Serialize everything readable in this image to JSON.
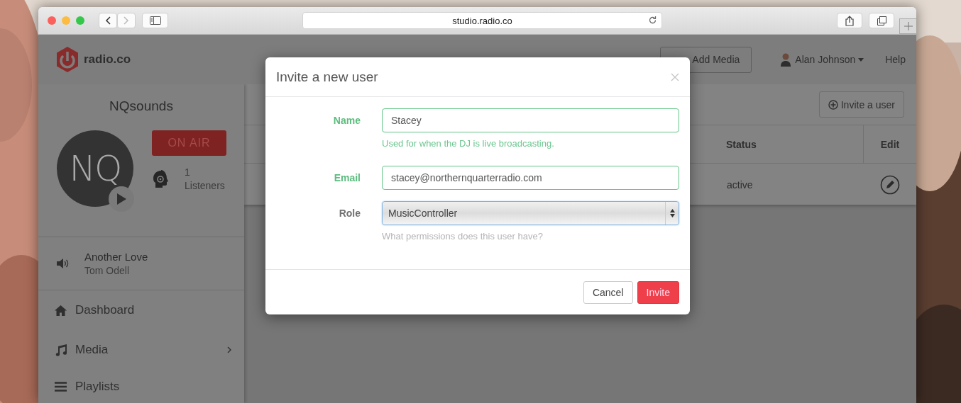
{
  "browser": {
    "url": "studio.radio.co"
  },
  "header": {
    "logo_text": "radio.co",
    "add_media_button": "Add Media",
    "user_name": "Alan Johnson",
    "help_link": "Help"
  },
  "sidebar": {
    "station_name": "NQsounds",
    "avatar_text": "NQ",
    "on_air_button": "ON AIR",
    "listeners_count": "1",
    "listeners_label": "Listeners",
    "now_playing": {
      "title": "Another Love",
      "artist": "Tom Odell"
    },
    "nav": [
      {
        "label": "Dashboard",
        "kind": "home",
        "has_submenu": false
      },
      {
        "label": "Media",
        "kind": "music",
        "has_submenu": true
      },
      {
        "label": "Playlists",
        "kind": "list",
        "has_submenu": false
      }
    ]
  },
  "main": {
    "invite_button": "Invite a user",
    "table": {
      "columns": [
        "Status",
        "Edit"
      ],
      "rows": [
        {
          "status": "active"
        }
      ]
    }
  },
  "modal": {
    "title": "Invite a new user",
    "fields": [
      {
        "label": "Name",
        "kind": "text",
        "value": "Stacey",
        "help": "Used for when the DJ is live broadcasting.",
        "valid": true,
        "focused": false
      },
      {
        "label": "Email",
        "kind": "text",
        "value": "stacey@northernquarterradio.com",
        "valid": true,
        "focused": false
      },
      {
        "label": "Role",
        "kind": "select",
        "value": "MusicController",
        "help": "What permissions does this user have?",
        "valid": false,
        "focused": true
      }
    ],
    "buttons": [
      {
        "label": "Cancel",
        "kind": "default"
      },
      {
        "label": "Invite",
        "kind": "primary"
      }
    ]
  }
}
